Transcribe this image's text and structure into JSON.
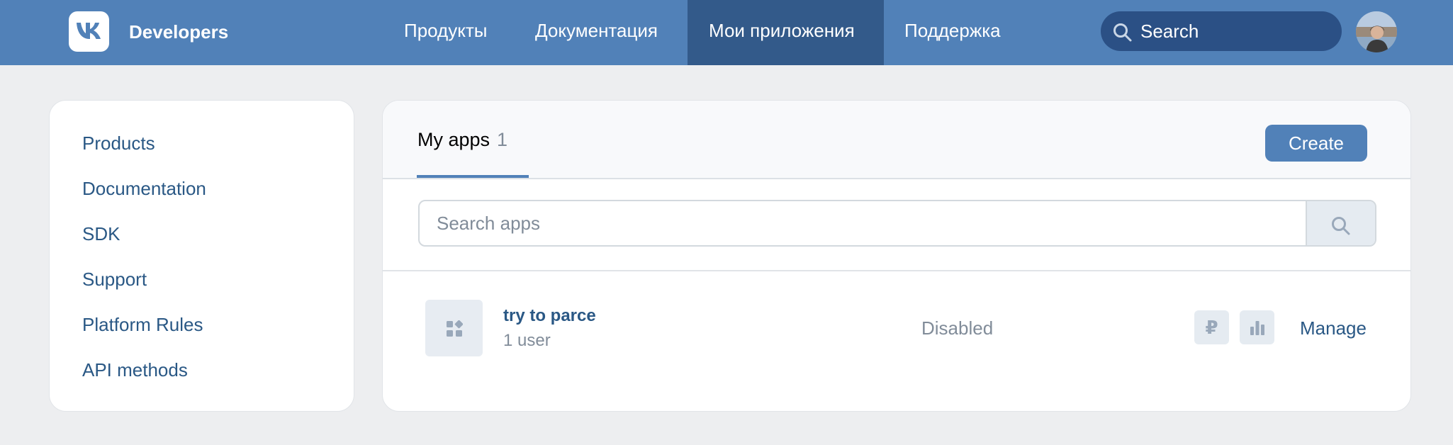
{
  "header": {
    "brand": "Developers",
    "nav": [
      "Продукты",
      "Документация",
      "Мои приложения",
      "Поддержка"
    ],
    "active_nav": "Мои приложения",
    "search_label": "Search"
  },
  "sidebar": {
    "items": [
      "Products",
      "Documentation",
      "SDK",
      "Support",
      "Platform Rules",
      "API methods"
    ]
  },
  "main": {
    "tab_label": "My apps",
    "tab_count": "1",
    "create_label": "Create",
    "search_placeholder": "Search apps",
    "apps": [
      {
        "name": "try to parce",
        "users": "1 user",
        "status": "Disabled",
        "currency_symbol": "₽",
        "manage_label": "Manage"
      }
    ]
  },
  "colors": {
    "header_bg": "#5181b8",
    "header_active": "#335a8a",
    "link": "#2a5885",
    "muted": "#818c99",
    "page_bg": "#edeef0"
  }
}
